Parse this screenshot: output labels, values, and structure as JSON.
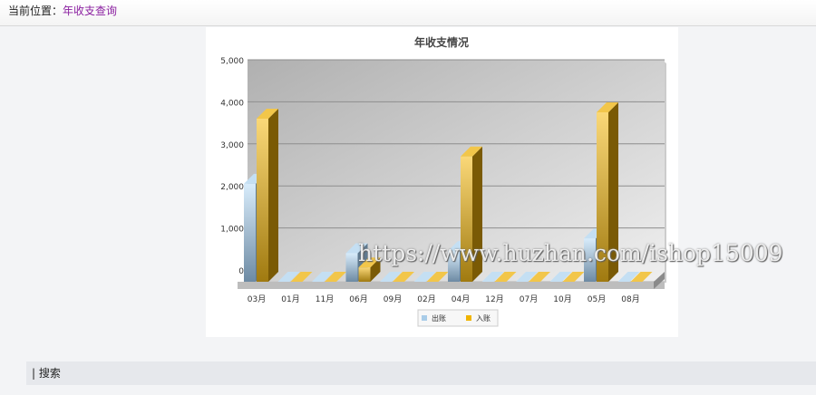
{
  "breadcrumb": {
    "label": "当前位置：",
    "current": "年收支查询"
  },
  "search": {
    "label": "| 搜索"
  },
  "watermark": "https://www.huzhan.com/ishop15009",
  "chart_data": {
    "type": "bar",
    "title": "年收支情况",
    "categories": [
      "03月",
      "01月",
      "11月",
      "06月",
      "09月",
      "02月",
      "04月",
      "12月",
      "07月",
      "10月",
      "05月",
      "08月"
    ],
    "series": [
      {
        "name": "出账",
        "color": "#a9cce8",
        "values": [
          2050,
          0,
          0,
          400,
          0,
          0,
          450,
          0,
          0,
          0,
          750,
          0
        ]
      },
      {
        "name": "入账",
        "color": "#e8b21c",
        "values": [
          3600,
          0,
          0,
          60,
          0,
          0,
          2700,
          0,
          0,
          0,
          3750,
          0
        ]
      }
    ],
    "yticks": [
      "0",
      "1,000",
      "2,000",
      "3,000",
      "4,000",
      "5,000"
    ],
    "ylim": [
      0,
      5000
    ],
    "grid": true,
    "legend": "bottom-center"
  }
}
